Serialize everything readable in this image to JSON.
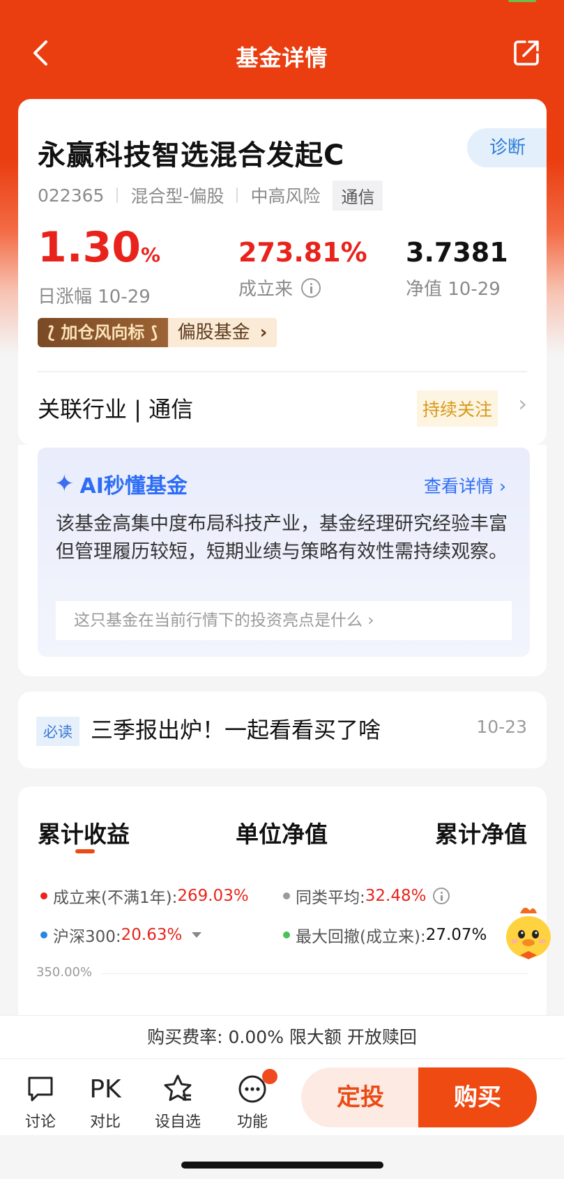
{
  "header": {
    "title": "基金详情",
    "back_icon": "chevron-left-icon",
    "share_icon": "share-icon"
  },
  "fund": {
    "name": "永赢科技智选混合发起C",
    "diagnose_label": "诊断",
    "code": "022365",
    "type": "混合型-偏股",
    "risk": "中高风险",
    "sector_tag": "通信",
    "daily_change_value": "1.30",
    "daily_change_unit": "%",
    "daily_change_label": "日涨幅 10-29",
    "since_inception_value": "273.81%",
    "since_inception_label": "成立来",
    "nav_value": "3.7381",
    "nav_label": "净值 10-29",
    "badge_dark": "加仓风向标",
    "badge_light": "偏股基金",
    "industry_label": "关联行业 | 通信",
    "follow_label": "持续关注"
  },
  "ai": {
    "title": "AI秒懂基金",
    "more_label": "查看详情",
    "summary": "该基金高集中度布局科技产业，基金经理研究经验丰富但管理履历较短，短期业绩与策略有效性需持续观察。",
    "question": "这只基金在当前行情下的投资亮点是什么"
  },
  "news": {
    "tag": "必读",
    "title": "三季报出炉！一起看看买了啥",
    "date": "10-23"
  },
  "chart": {
    "tabs": [
      "累计收益",
      "单位净值",
      "累计净值"
    ],
    "legend": {
      "since_label": "成立来(不满1年): ",
      "since_value": "269.03%",
      "peer_label": "同类平均: ",
      "peer_value": "32.48%",
      "index_label": "沪深300: ",
      "index_value": "20.63%",
      "drawdown_label": "最大回撤(成立来): ",
      "drawdown_value": "27.07%"
    },
    "y_tick_top": "350.00%",
    "colors": {
      "since": "#e8231c",
      "peer": "#9a9a9a",
      "index": "#2a86e6",
      "drawdown": "#4cc05a"
    }
  },
  "fee": {
    "text": "购买费率: 0.00%  限大额  开放赎回"
  },
  "bottom": {
    "discuss_label": "讨论",
    "pk_text": "PK",
    "compare_label": "对比",
    "watch_label": "设自选",
    "func_label": "功能",
    "sip_label": "定投",
    "buy_label": "购买"
  },
  "colors": {
    "brand": "#ea3e11",
    "accent_blue": "#2d6df6",
    "rise_red": "#e8231c"
  }
}
